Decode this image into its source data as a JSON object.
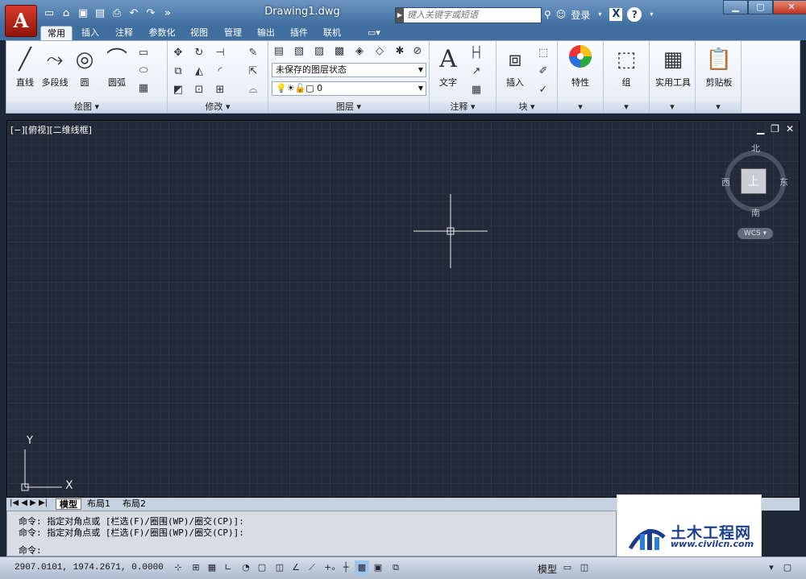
{
  "app": {
    "icon_letter": "A",
    "doc_title": "Drawing1.dwg"
  },
  "search": {
    "placeholder": "键入关键字或短语"
  },
  "user": {
    "login": "登录"
  },
  "qat": {
    "icons": [
      "new-icon",
      "open-icon",
      "save-icon",
      "saveas-icon",
      "print-icon",
      "undo-icon",
      "redo-icon",
      "more-icon"
    ]
  },
  "tabs": [
    "常用",
    "插入",
    "注释",
    "参数化",
    "视图",
    "管理",
    "输出",
    "插件",
    "联机"
  ],
  "active_tab": "常用",
  "draw_panel": {
    "title": "绘图 ▾",
    "tools": [
      "直线",
      "多段线",
      "圆",
      "圆弧"
    ]
  },
  "modify_panel": {
    "title": "修改 ▾"
  },
  "layers_panel": {
    "title": "图层 ▾",
    "layer_state": "未保存的图层状态",
    "current_layer": "0"
  },
  "annotation_panel": {
    "title": "注释 ▾",
    "text_label": "文字"
  },
  "block_panel": {
    "title": "块 ▾",
    "insert_label": "插入"
  },
  "properties_panel": {
    "label": "特性"
  },
  "group_panel": {
    "label": "组"
  },
  "utilities_panel": {
    "label": "实用工具"
  },
  "clipboard_panel": {
    "label": "剪贴板"
  },
  "viewport": {
    "label": "[−][俯视][二维线框]"
  },
  "navcube": {
    "north": "北",
    "south": "南",
    "east": "东",
    "west": "西",
    "face": "上",
    "wcs": "WCS ▾"
  },
  "ucs": {
    "y": "Y",
    "x": "X"
  },
  "layout_tabs": [
    "模型",
    "布局1",
    "布局2"
  ],
  "command": {
    "history": [
      "命令: 指定对角点或 [栏选(F)/圈围(WP)/圈交(CP)]:",
      "命令: 指定对角点或 [栏选(F)/圈围(WP)/圈交(CP)]:"
    ],
    "prompt": "命令:"
  },
  "status": {
    "coords": "2907.0101, 1974.2671, 0.0000",
    "model_label": "模型"
  },
  "watermark": {
    "title": "土木工程网",
    "url": "www.civilcn.com"
  }
}
